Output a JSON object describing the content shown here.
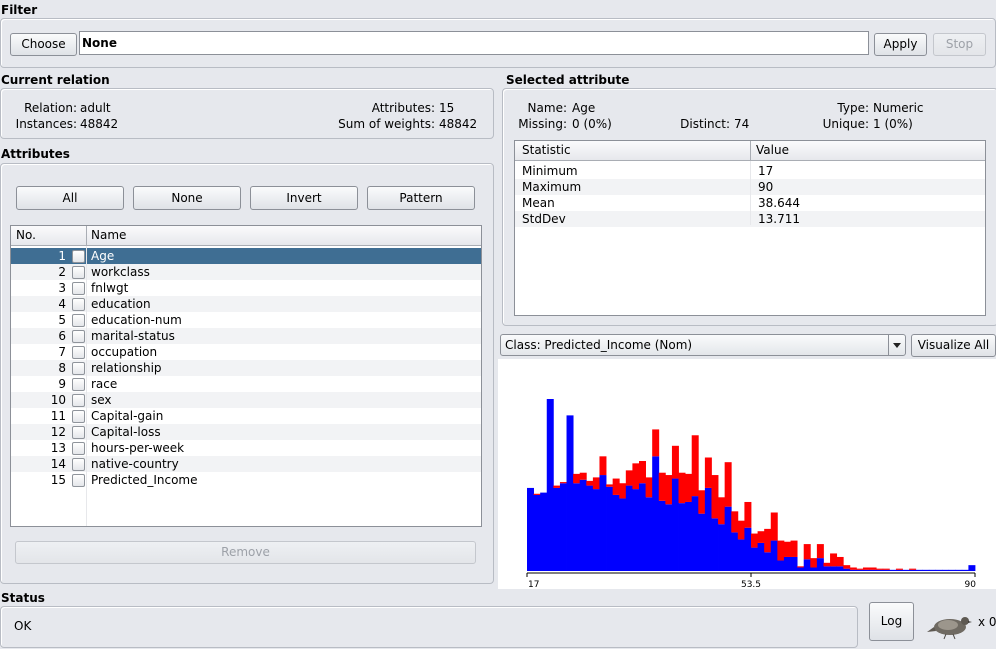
{
  "filter": {
    "title": "Filter",
    "choose_label": "Choose",
    "value": "None",
    "apply_label": "Apply",
    "stop_label": "Stop"
  },
  "current_relation": {
    "title": "Current relation",
    "relation_label": "Relation:",
    "relation_value": "adult",
    "instances_label": "Instances:",
    "instances_value": "48842",
    "attributes_label": "Attributes:",
    "attributes_value": "15",
    "sum_weights_label": "Sum of weights:",
    "sum_weights_value": "48842"
  },
  "attributes": {
    "title": "Attributes",
    "buttons": [
      "All",
      "None",
      "Invert",
      "Pattern"
    ],
    "col_no": "No.",
    "col_name": "Name",
    "rows": [
      {
        "no": "1",
        "name": "Age"
      },
      {
        "no": "2",
        "name": "workclass"
      },
      {
        "no": "3",
        "name": "fnlwgt"
      },
      {
        "no": "4",
        "name": "education"
      },
      {
        "no": "5",
        "name": "education-num"
      },
      {
        "no": "6",
        "name": "marital-status"
      },
      {
        "no": "7",
        "name": "occupation"
      },
      {
        "no": "8",
        "name": "relationship"
      },
      {
        "no": "9",
        "name": "race"
      },
      {
        "no": "10",
        "name": "sex"
      },
      {
        "no": "11",
        "name": "Capital-gain"
      },
      {
        "no": "12",
        "name": "Capital-loss"
      },
      {
        "no": "13",
        "name": "hours-per-week"
      },
      {
        "no": "14",
        "name": "native-country"
      },
      {
        "no": "15",
        "name": "Predicted_Income"
      }
    ],
    "remove_label": "Remove"
  },
  "selected_attribute": {
    "title": "Selected attribute",
    "name_label": "Name:",
    "name_value": "Age",
    "type_label": "Type:",
    "type_value": "Numeric",
    "missing_label": "Missing:",
    "missing_value": "0 (0%)",
    "distinct_label": "Distinct:",
    "distinct_value": "74",
    "unique_label": "Unique:",
    "unique_value": "1 (0%)",
    "col_statistic": "Statistic",
    "col_value": "Value",
    "stats": [
      {
        "k": "Minimum",
        "v": "17"
      },
      {
        "k": "Maximum",
        "v": "90"
      },
      {
        "k": "Mean",
        "v": "38.644"
      },
      {
        "k": "StdDev",
        "v": "13.711"
      }
    ]
  },
  "class_select": {
    "value": "Class: Predicted_Income (Nom)",
    "visualize_label": "Visualize All"
  },
  "chart_data": {
    "type": "bar",
    "stacked": true,
    "x_ticks": [
      "17",
      "53.5",
      "90"
    ],
    "xlim": [
      17,
      90
    ],
    "colors": {
      "blue": "#0000ff",
      "red": "#ff0000"
    },
    "series": [
      {
        "color": "blue",
        "values": [
          71,
          65,
          67,
          147,
          71,
          75,
          133,
          75,
          78,
          73,
          70,
          82,
          72,
          65,
          62,
          73,
          70,
          75,
          63,
          98,
          60,
          57,
          79,
          58,
          59,
          64,
          49,
          71,
          45,
          40,
          55,
          33,
          27,
          37,
          20,
          24,
          16,
          26,
          9,
          12,
          12,
          3,
          10,
          3,
          11,
          4,
          4,
          4,
          2,
          1,
          1,
          1,
          1,
          1,
          1,
          1,
          1,
          1,
          1,
          1,
          1,
          1,
          1,
          1,
          1,
          1,
          1,
          5
        ]
      },
      {
        "color": "red",
        "values": [
          0,
          1,
          0,
          0,
          2,
          1,
          0,
          8,
          6,
          4,
          10,
          16,
          2,
          14,
          13,
          13,
          22,
          19,
          17,
          23,
          24,
          25,
          28,
          26,
          24,
          52,
          20,
          26,
          37,
          23,
          38,
          18,
          16,
          22,
          12,
          10,
          20,
          24,
          17,
          13,
          14,
          1,
          13,
          8,
          12,
          3,
          11,
          8,
          3,
          2,
          1,
          2,
          2,
          1,
          1,
          0,
          1,
          0,
          1,
          0,
          0,
          0,
          0,
          0,
          0,
          0,
          0,
          0
        ]
      }
    ]
  },
  "status": {
    "title": "Status",
    "text": "OK",
    "log_label": "Log",
    "count": "x 0"
  }
}
